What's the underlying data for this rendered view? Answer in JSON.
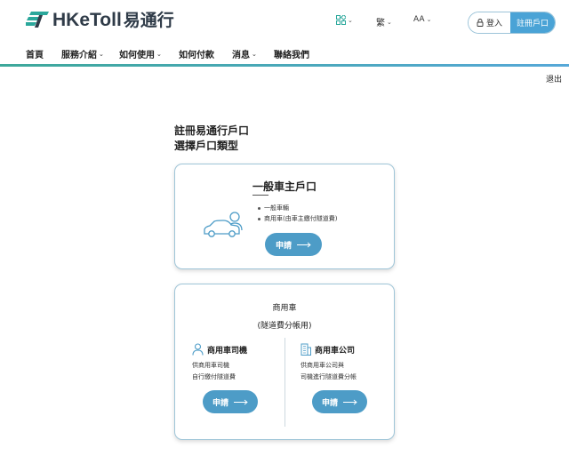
{
  "header": {
    "logo_latin": "HKeToll",
    "logo_chinese": "易通行",
    "language_label": "繁",
    "font_size_label": "AA",
    "login_label": "登入",
    "register_label": "註冊戶口"
  },
  "nav": {
    "items": [
      {
        "label": "首頁",
        "dropdown": false
      },
      {
        "label": "服務介紹",
        "dropdown": true
      },
      {
        "label": "如何使用",
        "dropdown": true
      },
      {
        "label": "如何付款",
        "dropdown": false
      },
      {
        "label": "消息",
        "dropdown": true
      },
      {
        "label": "聯絡我們",
        "dropdown": false
      }
    ],
    "logout_label": "退出"
  },
  "page": {
    "title_line1": "註冊易通行戶口",
    "title_line2": "選擇戶口類型"
  },
  "card_general": {
    "title": "一般車主戶口",
    "bullets": [
      "一般車輛",
      "商用車(由車主繳付隧道費)"
    ],
    "apply_label": "申請"
  },
  "card_commercial": {
    "title": "商用車",
    "subtitle": "(隧道費分帳用)",
    "driver": {
      "title": "商用車司機",
      "desc_line1": "供商用車司機",
      "desc_line2": "自行繳付隧道費",
      "apply_label": "申請"
    },
    "company": {
      "title": "商用車公司",
      "desc_line1": "供商用車公司與",
      "desc_line2": "司機進行隧道費分帳",
      "apply_label": "申請"
    }
  },
  "colors": {
    "accent": "#4d9cc7",
    "register_bg": "#4aa3d6",
    "nav_line_start": "#3da89a",
    "nav_line_end": "#56a8d8",
    "card_border": "#9fc5d8"
  }
}
